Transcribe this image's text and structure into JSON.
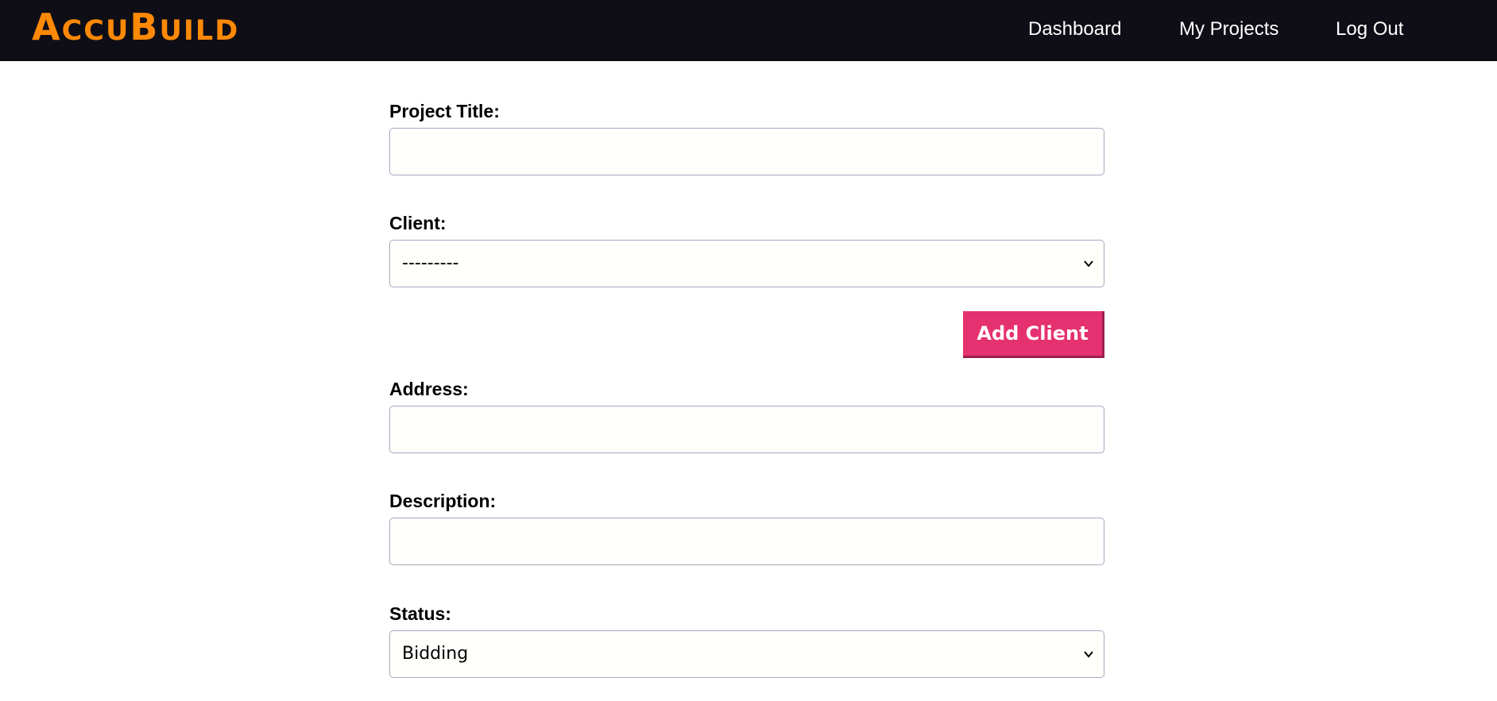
{
  "app": {
    "logo_first": "A",
    "logo_mid": "CCU",
    "logo_b": "B",
    "logo_rest": "UILD"
  },
  "nav": {
    "dashboard": "Dashboard",
    "my_projects": "My Projects",
    "log_out": "Log Out"
  },
  "form": {
    "project_title": {
      "label": "Project Title:",
      "value": "",
      "placeholder": ""
    },
    "client": {
      "label": "Client:",
      "selected": "---------"
    },
    "add_client_label": "Add Client",
    "address": {
      "label": "Address:",
      "value": "",
      "placeholder": ""
    },
    "description": {
      "label": "Description:",
      "value": "",
      "placeholder": ""
    },
    "status": {
      "label": "Status:",
      "selected": "Bidding"
    }
  },
  "colors": {
    "navbar_bg": "#0f0e17",
    "logo": "#ff8906",
    "accent_button": "#e53170",
    "input_border": "#a7a9be"
  },
  "icons": {
    "client_select": "chevron-down-icon",
    "status_select": "chevron-down-icon"
  }
}
